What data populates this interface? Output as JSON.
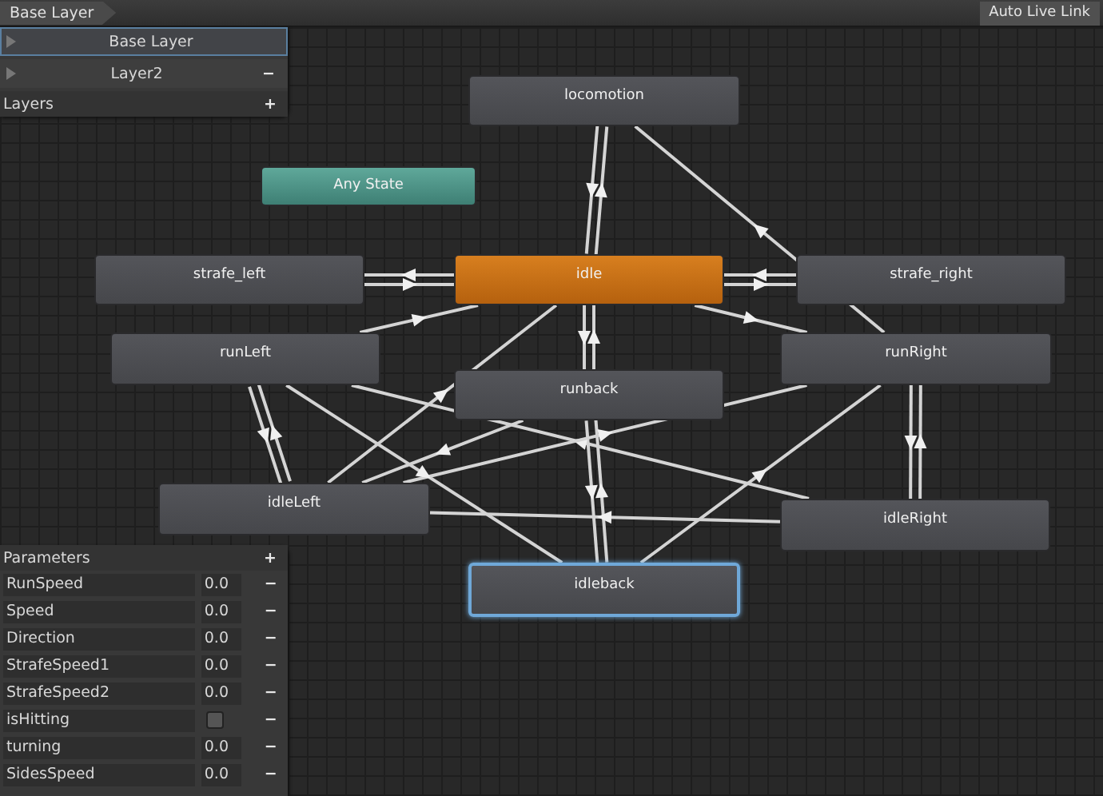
{
  "breadcrumb": "Base Layer",
  "live_link_button": "Auto Live Link",
  "layers": {
    "title": "Layers",
    "add": "+",
    "items": [
      {
        "name": "Base Layer",
        "selected": true
      },
      {
        "name": "Layer2",
        "selected": false,
        "remove": "−"
      }
    ]
  },
  "states": [
    {
      "name": "locomotion",
      "kind": "state",
      "selected": false
    },
    {
      "name": "Any State",
      "kind": "any",
      "selected": false
    },
    {
      "name": "strafe_left",
      "kind": "state",
      "selected": false
    },
    {
      "name": "idle",
      "kind": "default",
      "selected": false
    },
    {
      "name": "strafe_right",
      "kind": "state",
      "selected": false
    },
    {
      "name": "runLeft",
      "kind": "state",
      "selected": false
    },
    {
      "name": "runRight",
      "kind": "state",
      "selected": false
    },
    {
      "name": "runback",
      "kind": "state",
      "selected": false
    },
    {
      "name": "idleLeft",
      "kind": "state",
      "selected": false
    },
    {
      "name": "idleRight",
      "kind": "state",
      "selected": false
    },
    {
      "name": "idleback",
      "kind": "state",
      "selected": true
    }
  ],
  "parameters": {
    "title": "Parameters",
    "add": "+",
    "items": [
      {
        "name": "RunSpeed",
        "kind": "float",
        "value": "0.0",
        "remove": "−"
      },
      {
        "name": "Speed",
        "kind": "float",
        "value": "0.0",
        "remove": "−"
      },
      {
        "name": "Direction",
        "kind": "float",
        "value": "0.0",
        "remove": "−"
      },
      {
        "name": "StrafeSpeed1",
        "kind": "float",
        "value": "0.0",
        "remove": "−"
      },
      {
        "name": "StrafeSpeed2",
        "kind": "float",
        "value": "0.0",
        "remove": "−"
      },
      {
        "name": "isHitting",
        "kind": "bool",
        "checked": false,
        "remove": "−"
      },
      {
        "name": "turning",
        "kind": "float",
        "value": "0.0",
        "remove": "−"
      },
      {
        "name": "SidesSpeed",
        "kind": "float",
        "value": "0.0",
        "remove": "−"
      }
    ]
  }
}
